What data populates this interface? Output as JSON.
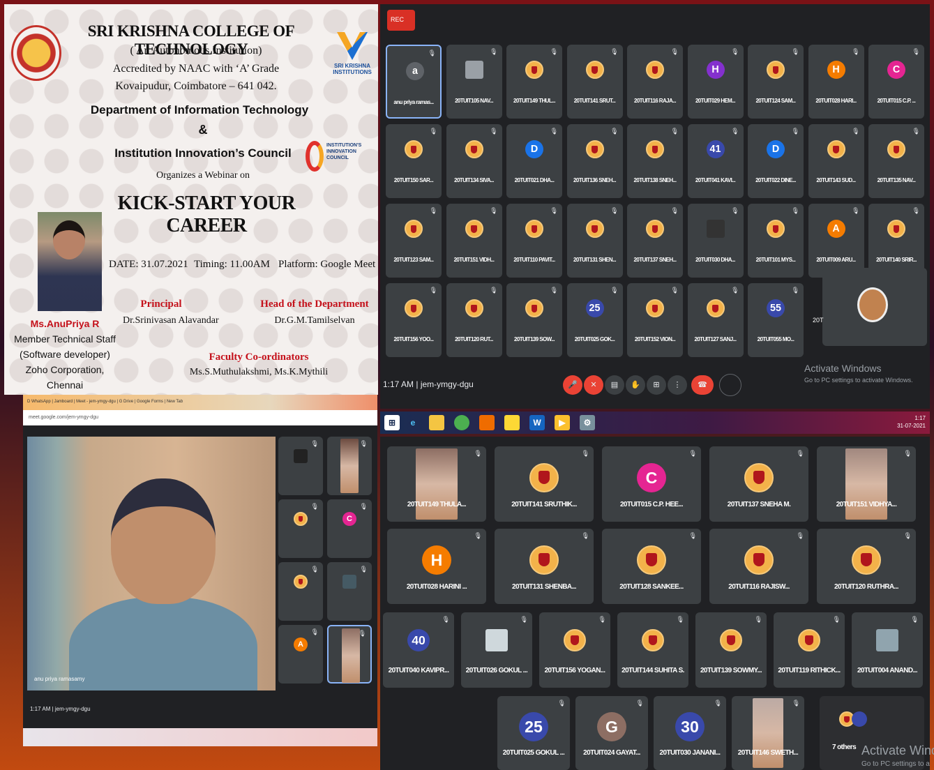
{
  "poster": {
    "college": "SRI KRISHNA COLLEGE OF TECHNOLOGY",
    "autonomous": "( An Autonomous Institution)",
    "accredited": "Accredited  by NAAC with ‘A’ Grade",
    "address": "Kovaipudur, Coimbatore – 641 042.",
    "dept": "Department of Information Technology",
    "amp": "&",
    "council": "Institution Innovation’s Council",
    "organizes": "Organizes a Webinar on",
    "title": "KICK-START YOUR CAREER",
    "date": "DATE: 31.07.2021",
    "timing": "Timing: 11.00AM",
    "platform": "Platform: Google Meet",
    "principal_role": "Principal",
    "principal_name": "Dr.Srinivasan Alavandar",
    "hod_role": "Head of the Department",
    "hod_name": "Dr.G.M.Tamilselvan",
    "coord_role": "Faculty Co-ordinators",
    "coord_names": "Ms.S.Muthulakshmi, Ms.K.Mythili",
    "speaker_name": "Ms.AnuPriya R",
    "speaker_l1": "Member Technical Staff",
    "speaker_l2": "(Software developer)",
    "speaker_l3": "Zoho Corporation,",
    "speaker_l4": "Chennai",
    "logo_right_text": "SRI KRISHNA INSTITUTIONS",
    "iic_text": "INSTITUTION'S INNOVATION COUNCIL"
  },
  "meet1": {
    "rec": "REC",
    "time_code": "1:17 AM  |  jem-ymgy-dgu",
    "watermark1": "Activate Windows",
    "watermark2": "Go to PC settings to activate Windows.",
    "self_label": "20T",
    "rows": [
      [
        [
          "anu priya ramas...",
          "a",
          "#5f6368"
        ],
        [
          "20TUIT105 NAV...",
          "img",
          "#9aa0a6"
        ],
        [
          "20TUIT149 THUL...",
          "e",
          ""
        ],
        [
          "20TUIT141 SRUT...",
          "e",
          ""
        ],
        [
          "20TUIT116 RAJA...",
          "e",
          ""
        ],
        [
          "20TUIT029 HEM...",
          "H",
          "#8430ce"
        ],
        [
          "20TUIT124 SAM...",
          "e",
          ""
        ],
        [
          "20TUIT028 HARI...",
          "H",
          "#f57c00"
        ],
        [
          "20TUIT015 C.P. ...",
          "C",
          "#e52592"
        ]
      ],
      [
        [
          "20TUIT150 SAR...",
          "e",
          ""
        ],
        [
          "20TUIT134 SIVA...",
          "e",
          ""
        ],
        [
          "20TUIT021 DHA...",
          "D",
          "#1a73e8"
        ],
        [
          "20TUIT136 SNEH...",
          "e",
          ""
        ],
        [
          "20TUIT138 SNEH...",
          "e",
          ""
        ],
        [
          "20TUIT041 KAVI...",
          "41",
          "#3949ab"
        ],
        [
          "20TUIT022 DINE...",
          "D",
          "#1a73e8"
        ],
        [
          "20TUIT143 SUD...",
          "e",
          ""
        ],
        [
          "20TUIT135 NAV...",
          "e",
          ""
        ]
      ],
      [
        [
          "20TUIT123 SAM...",
          "e",
          ""
        ],
        [
          "20TUIT151 VIDH...",
          "e",
          ""
        ],
        [
          "20TUIT110 PAVIT...",
          "e",
          ""
        ],
        [
          "20TUIT131 SHEN...",
          "e",
          ""
        ],
        [
          "20TUIT137 SNEH...",
          "e",
          ""
        ],
        [
          "20TUIT030 DHA...",
          "img",
          "#333"
        ],
        [
          "20TUIT101 MYS...",
          "e",
          ""
        ],
        [
          "20TUIT009 ARU...",
          "A",
          "#f57c00"
        ],
        [
          "20TUIT140 SRIR...",
          "e",
          ""
        ]
      ],
      [
        [
          "20TUIT156 YOO...",
          "e",
          ""
        ],
        [
          "20TUIT120 RUT...",
          "e",
          ""
        ],
        [
          "20TUIT139 SOW...",
          "e",
          ""
        ],
        [
          "20TUIT025 GOK...",
          "25",
          "#3949ab"
        ],
        [
          "20TUIT152 VION...",
          "e",
          ""
        ],
        [
          "20TUIT127 SANJ...",
          "e",
          ""
        ],
        [
          "20TUIT055 MO...",
          "55",
          "#3949ab"
        ]
      ]
    ]
  },
  "taskbar": {
    "time": "1:17",
    "date": "31-07-2021"
  },
  "meet2": {
    "watermark": "Activate Windows",
    "watermark2": "Go to PC settings to a",
    "others": "7 others",
    "rows": [
      [
        [
          "20TUIT149 THULA...",
          "photo",
          "#8d6e63"
        ],
        [
          "20TUIT141 SRUTHIK...",
          "e",
          ""
        ],
        [
          "20TUIT015 C.P. HEE...",
          "C",
          "#e52592"
        ],
        [
          "20TUIT137 SNEHA M.",
          "e",
          ""
        ],
        [
          "20TUIT151 VIDHYA...",
          "photo",
          "#a1887f"
        ]
      ],
      [
        [
          "20TUIT028 HARINI ...",
          "H",
          "#f57c00"
        ],
        [
          "20TUIT131 SHENBA...",
          "e",
          ""
        ],
        [
          "20TUIT128 SANKEE...",
          "e",
          ""
        ],
        [
          "20TUIT116 RAJISW...",
          "e",
          ""
        ],
        [
          "20TUIT120 RUTHRA...",
          "e",
          ""
        ]
      ],
      [
        [
          "20TUIT040 KAVIPR...",
          "40",
          "#3949ab"
        ],
        [
          "20TUIT026 GOKUL ...",
          "img",
          "#cfd8dc"
        ],
        [
          "20TUIT156 YOGAN...",
          "e",
          ""
        ],
        [
          "20TUIT144 SUHITA S.",
          "e",
          ""
        ],
        [
          "20TUIT139 SOWMY...",
          "e",
          ""
        ],
        [
          "20TUIT119 RITHICK...",
          "e",
          ""
        ],
        [
          "20TUIT004 ANAND...",
          "img",
          "#90a4ae"
        ]
      ],
      [
        [
          "20TUIT025 GOKUL ...",
          "25",
          "#3949ab"
        ],
        [
          "20TUIT024 GAYAT...",
          "G",
          "#8d6e63"
        ],
        [
          "20TUIT030 JANANI...",
          "30",
          "#3949ab"
        ],
        [
          "20TUIT146 SWETH...",
          "photo",
          "#bcaaa4"
        ]
      ]
    ]
  },
  "small": {
    "tabs": "D   WhatsApp   |   Jamboard   |   Meet - jem-ymgy-dgu   |   G Drive   |   Google Forms   |   New Tab",
    "url": "meet.google.com/jem-ymgy-dgu",
    "speaker_label": "anu priya ramasamy",
    "bottom": "1:17 AM  |  jem-ymgy-dgu"
  }
}
